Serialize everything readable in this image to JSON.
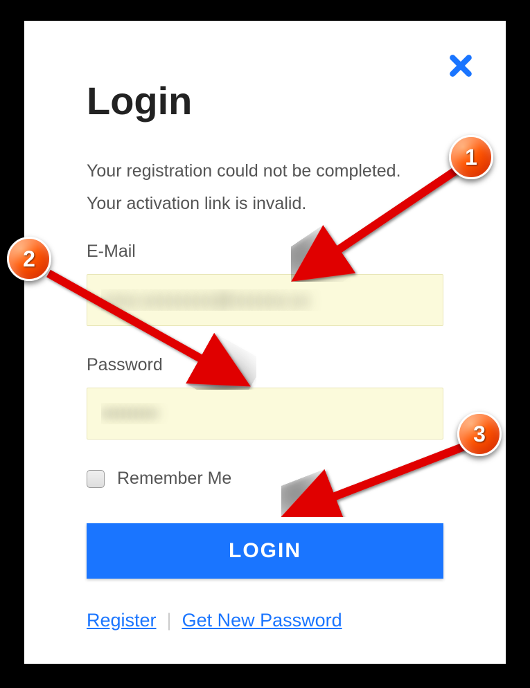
{
  "modal": {
    "title": "Login",
    "error_line1": "Your registration could not be completed.",
    "error_line2": "Your activation link is invalid.",
    "email_label": "E-Mail",
    "email_value": "xxxx.xxxxxxxx@xxxxxx.xx",
    "password_label": "Password",
    "password_value": "xxxxxxxxx",
    "remember_label": "Remember Me",
    "login_button": "LOGIN",
    "register_link": "Register",
    "get_password_link": "Get New Password"
  },
  "annotations": {
    "badge1": "1",
    "badge2": "2",
    "badge3": "3"
  },
  "colors": {
    "accent": "#1a75ff",
    "autofill": "#fbfadb",
    "badge": "#ff5500"
  }
}
